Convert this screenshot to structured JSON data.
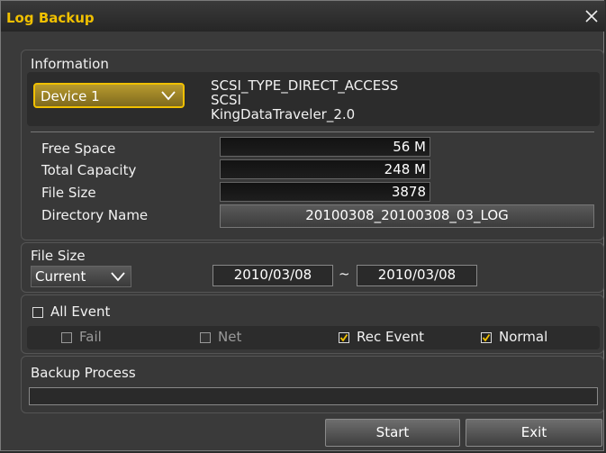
{
  "window": {
    "title": "Log Backup"
  },
  "information": {
    "label": "Information",
    "device": "Device 1",
    "device_info": [
      "SCSI_TYPE_DIRECT_ACCESS",
      "SCSI",
      "KingDataTraveler_2.0"
    ],
    "free_space_label": "Free Space",
    "free_space": "56 M",
    "total_capacity_label": "Total Capacity",
    "total_capacity": "248 M",
    "file_size_label": "File Size",
    "file_size": "3878",
    "directory_label": "Directory Name",
    "directory": "20100308_20100308_03_LOG"
  },
  "filesize_section": {
    "label": "File Size",
    "mode": "Current",
    "date_from": "2010/03/08",
    "tilde": "~",
    "date_to": "2010/03/08"
  },
  "events": {
    "all_event": {
      "label": "All Event",
      "checked": false
    },
    "fail": {
      "label": "Fail",
      "checked": false
    },
    "net": {
      "label": "Net",
      "checked": false
    },
    "rec_event": {
      "label": "Rec Event",
      "checked": true
    },
    "normal": {
      "label": "Normal",
      "checked": true
    }
  },
  "backup": {
    "label": "Backup Process",
    "progress": 0
  },
  "buttons": {
    "start": "Start",
    "exit": "Exit"
  },
  "colors": {
    "title": "#f0c000",
    "device_border": "#f0c000",
    "device_bg": "#a08a2a"
  }
}
